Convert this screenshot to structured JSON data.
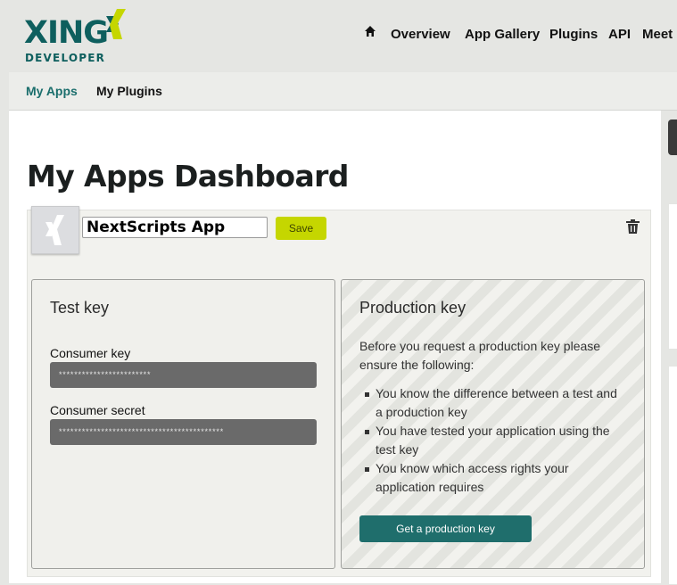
{
  "brand": {
    "wordmark": "XING",
    "tagline": "DEVELOPER",
    "colors": {
      "teal": "#0e5f5e",
      "lime": "#c5d600"
    }
  },
  "top_nav": {
    "home_icon": "home-icon",
    "items": [
      "Overview",
      "App Gallery",
      "Plugins",
      "API",
      "Meet"
    ]
  },
  "sub_nav": {
    "items": [
      {
        "label": "My Apps",
        "active": true
      },
      {
        "label": "My Plugins",
        "active": false
      }
    ]
  },
  "page": {
    "title": "My Apps Dashboard"
  },
  "app": {
    "icon": "xing-logo-icon",
    "name": "NextScripts App",
    "save_label": "Save",
    "delete_icon": "trash-icon"
  },
  "test_key": {
    "title": "Test key",
    "consumer_key_label": "Consumer key",
    "consumer_key_value": "************************",
    "consumer_secret_label": "Consumer secret",
    "consumer_secret_value": "*******************************************"
  },
  "production_key": {
    "title": "Production key",
    "intro": "Before you request a production key please ensure the following:",
    "requirements": [
      "You know the difference between a test and a production key",
      "You have tested your application using the test key",
      "You know which access rights your application requires"
    ],
    "button_label": "Get a production key"
  }
}
